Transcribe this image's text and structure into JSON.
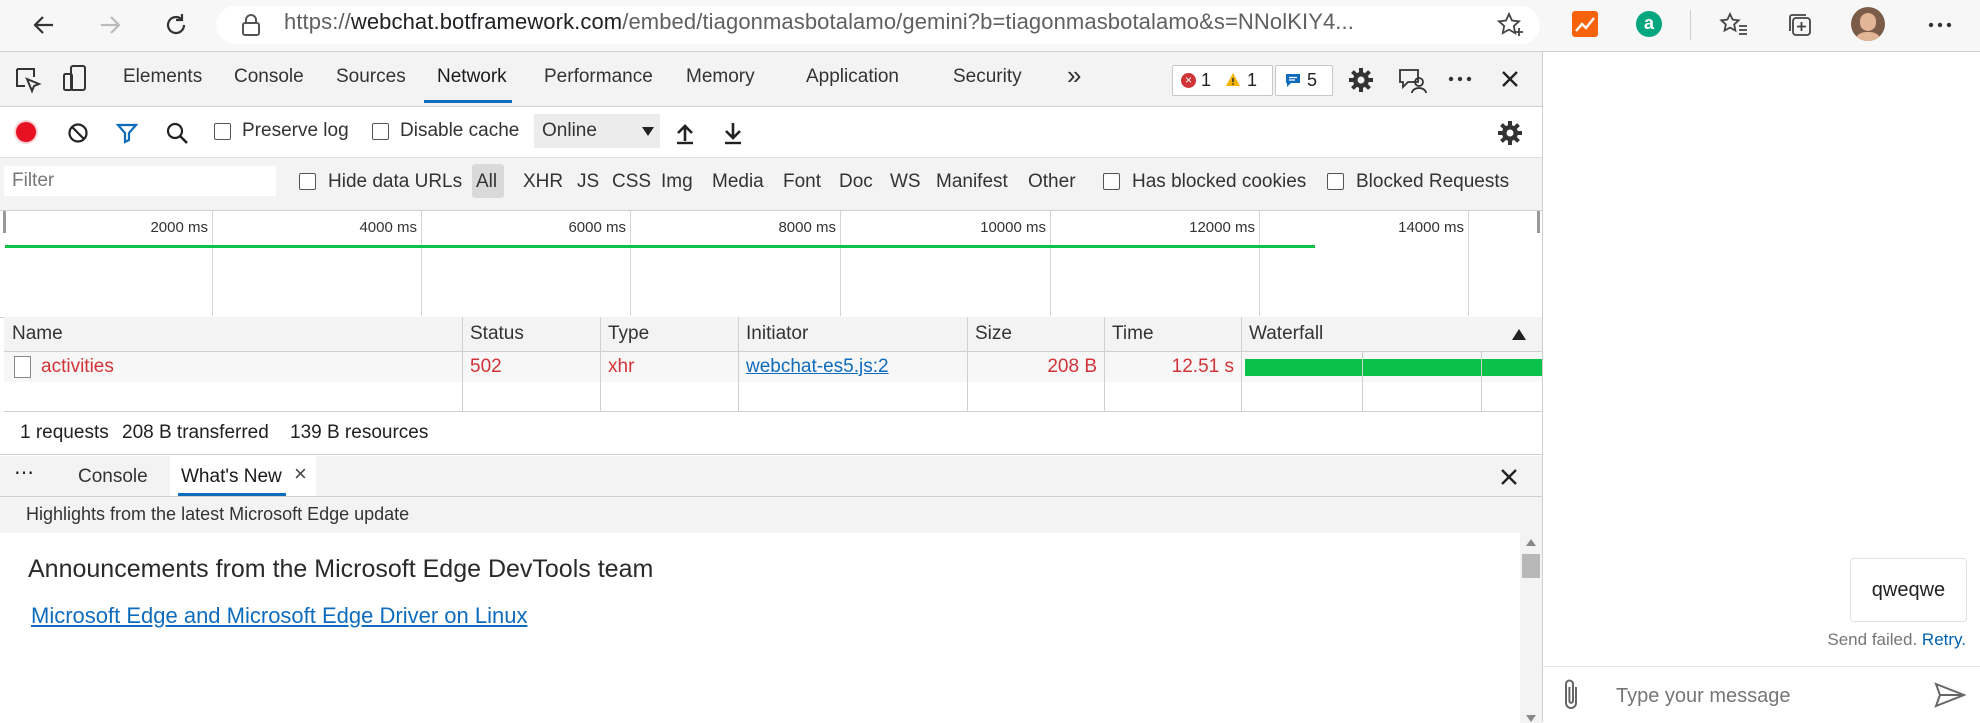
{
  "browser": {
    "url_scheme": "https://",
    "url_domain": "webchat.botframework.com",
    "url_rest": "/embed/tiagonmasbotalamo/gemini?b=tiagonmasbotalamo&s=NNolKIY4..."
  },
  "devtools": {
    "tabs": [
      "Elements",
      "Console",
      "Sources",
      "Network",
      "Performance",
      "Memory",
      "Application",
      "Security"
    ],
    "more_tabs_label": "»",
    "error_count": "1",
    "warning_count": "1",
    "message_count": "5",
    "toolbar": {
      "preserve_log": "Preserve log",
      "disable_cache": "Disable cache",
      "throttle_value": "Online"
    },
    "filter": {
      "placeholder": "Filter",
      "hide_data_urls": "Hide data URLs",
      "types": [
        "All",
        "XHR",
        "JS",
        "CSS",
        "Img",
        "Media",
        "Font",
        "Doc",
        "WS",
        "Manifest",
        "Other"
      ],
      "has_blocked_cookies": "Has blocked cookies",
      "blocked_requests": "Blocked Requests"
    },
    "overview_ticks": [
      "2000 ms",
      "4000 ms",
      "6000 ms",
      "8000 ms",
      "10000 ms",
      "12000 ms",
      "14000 ms"
    ],
    "table": {
      "headers": [
        "Name",
        "Status",
        "Type",
        "Initiator",
        "Size",
        "Time",
        "Waterfall"
      ],
      "rows": [
        {
          "name": "activities",
          "status": "502",
          "type": "xhr",
          "initiator": "webchat-es5.js:2",
          "size": "208 B",
          "time": "12.51 s"
        }
      ]
    },
    "summary": {
      "requests": "1 requests",
      "transferred": "208 B transferred",
      "resources": "139 B resources"
    },
    "drawer": {
      "more_label": "⋯",
      "tabs": [
        "Console",
        "What's New"
      ],
      "close_tab_label": "×",
      "highlights": "Highlights from the latest Microsoft Edge update",
      "announcement_heading": "Announcements from the Microsoft Edge DevTools team",
      "link": "Microsoft Edge and Microsoft Edge Driver on Linux"
    }
  },
  "webchat": {
    "message": "qweqwe",
    "send_failed": "Send failed.",
    "retry": "Retry.",
    "input_placeholder": "Type your message"
  },
  "colors": {
    "accent": "#0f6cbd",
    "error": "#d13438",
    "waterfall": "#0ac24a",
    "record": "#e81123"
  }
}
